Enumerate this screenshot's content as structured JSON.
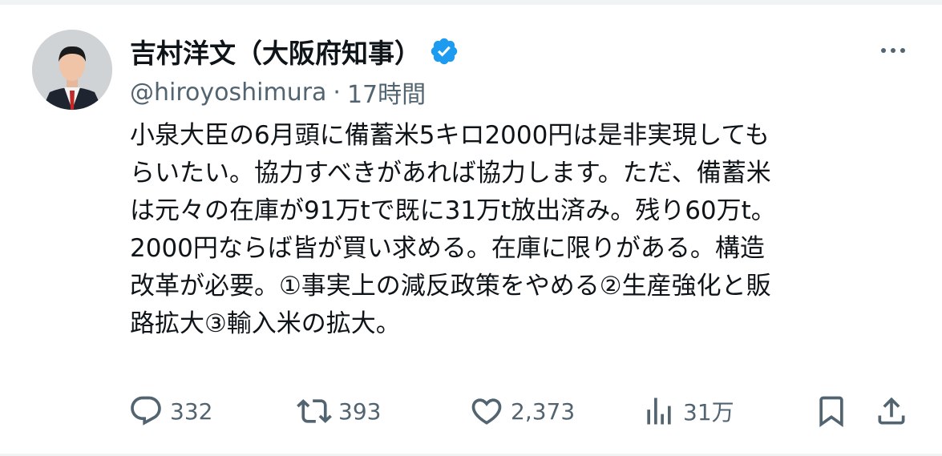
{
  "author": {
    "display_name": "吉村洋文（大阪府知事）",
    "handle": "@hiroyoshimura",
    "separator": "·",
    "time": "17時間",
    "verified": true
  },
  "tweet": {
    "text": "小泉大臣の6月頭に備蓄米5キロ2000円は是非実現しても\nらいたい。協力すべきがあれば協力します。ただ、備蓄米\nは元々の在庫が91万tで既に31万t放出済み。残り60万t。\n2000円ならば皆が買い求める。在庫に限りがある。構造\n改革が必要。①事実上の減反政策をやめる②生産強化と販\n路拡大③輸入米の拡大。"
  },
  "actions": {
    "replies": "332",
    "reposts": "393",
    "likes": "2,373",
    "views": "31万"
  },
  "icons": {
    "reply": "reply-icon",
    "repost": "repost-icon",
    "like": "heart-icon",
    "views": "views-icon",
    "bookmark": "bookmark-icon",
    "share": "share-icon",
    "verified": "verified-badge-icon",
    "more": "more-options-icon"
  },
  "colors": {
    "text": "#0f1419",
    "secondary": "#536471",
    "verified": "#1d9bf0",
    "divider": "#eff3f4"
  }
}
